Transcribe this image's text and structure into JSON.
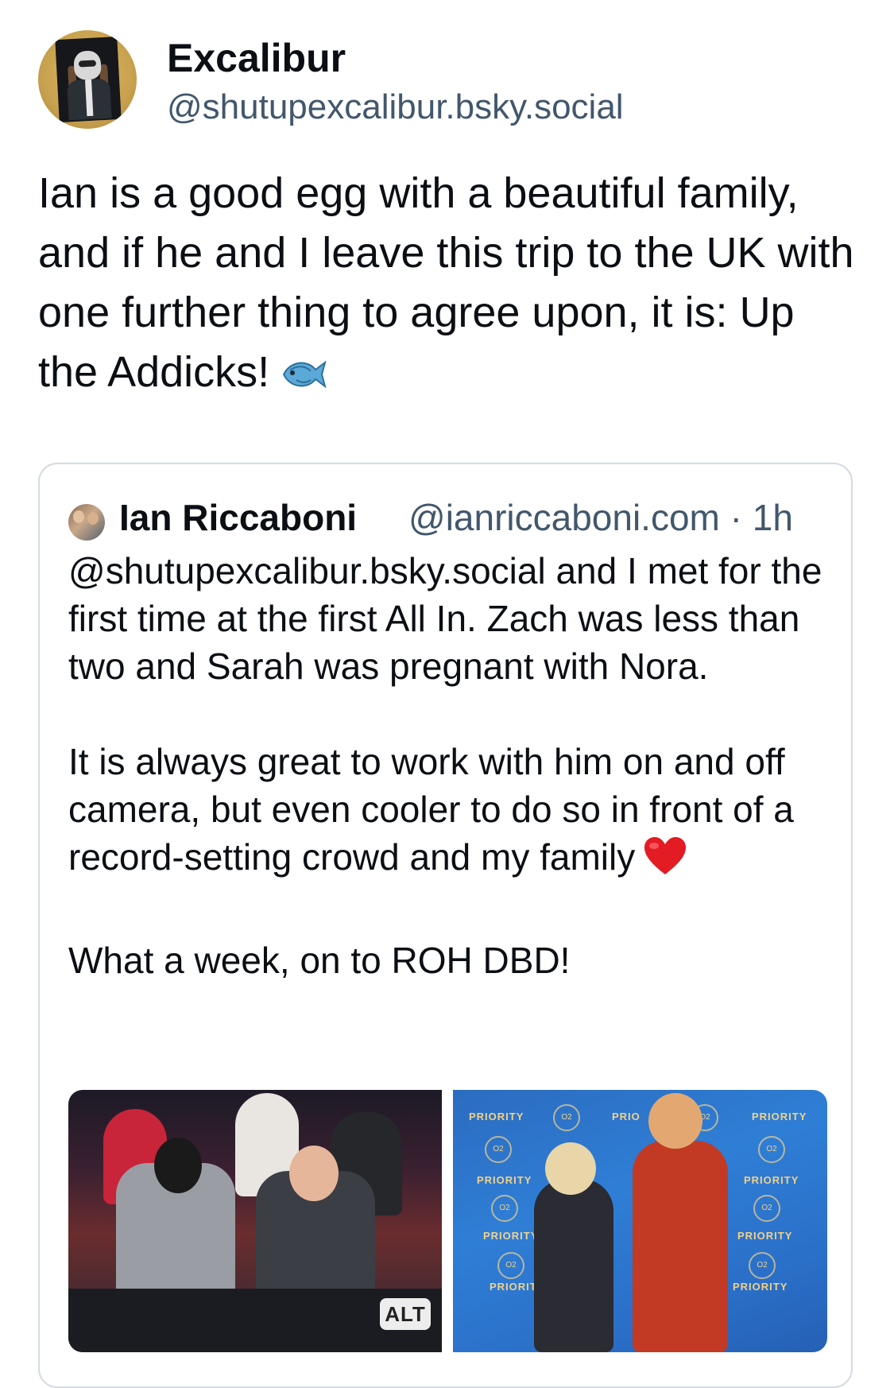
{
  "post": {
    "author_name": "Excalibur",
    "author_handle": "@shutupexcalibur.bsky.social",
    "text": "Ian is a good egg with a beautiful family, and if he and I leave this trip to the UK with one further thing to agree upon, it is: Up the Addicks!",
    "emoji": "fish-emoji"
  },
  "quoted_post": {
    "author_name": "Ian Riccaboni",
    "author_handle": "@ianriccaboni.com",
    "separator": "·",
    "time": "1h",
    "paragraph1": "@shutupexcalibur.bsky.social and I met for the first time at the first All In. Zach was less than two and Sarah was pregnant with Nora.",
    "paragraph2": "It is always great to work with him on and off camera, but even cooler to do so in front of a record-setting crowd and my family",
    "paragraph2_emoji": "heart-emoji",
    "paragraph3": "What a week, on to ROH DBD!",
    "images": [
      {
        "alt_badge": "ALT",
        "kind": "photo-commentary-desk"
      },
      {
        "kind": "photo-kids-o2-priority-backdrop"
      }
    ]
  },
  "colors": {
    "text_primary": "#0b0f14",
    "text_secondary": "#42576c",
    "border": "#d4dbe2"
  }
}
